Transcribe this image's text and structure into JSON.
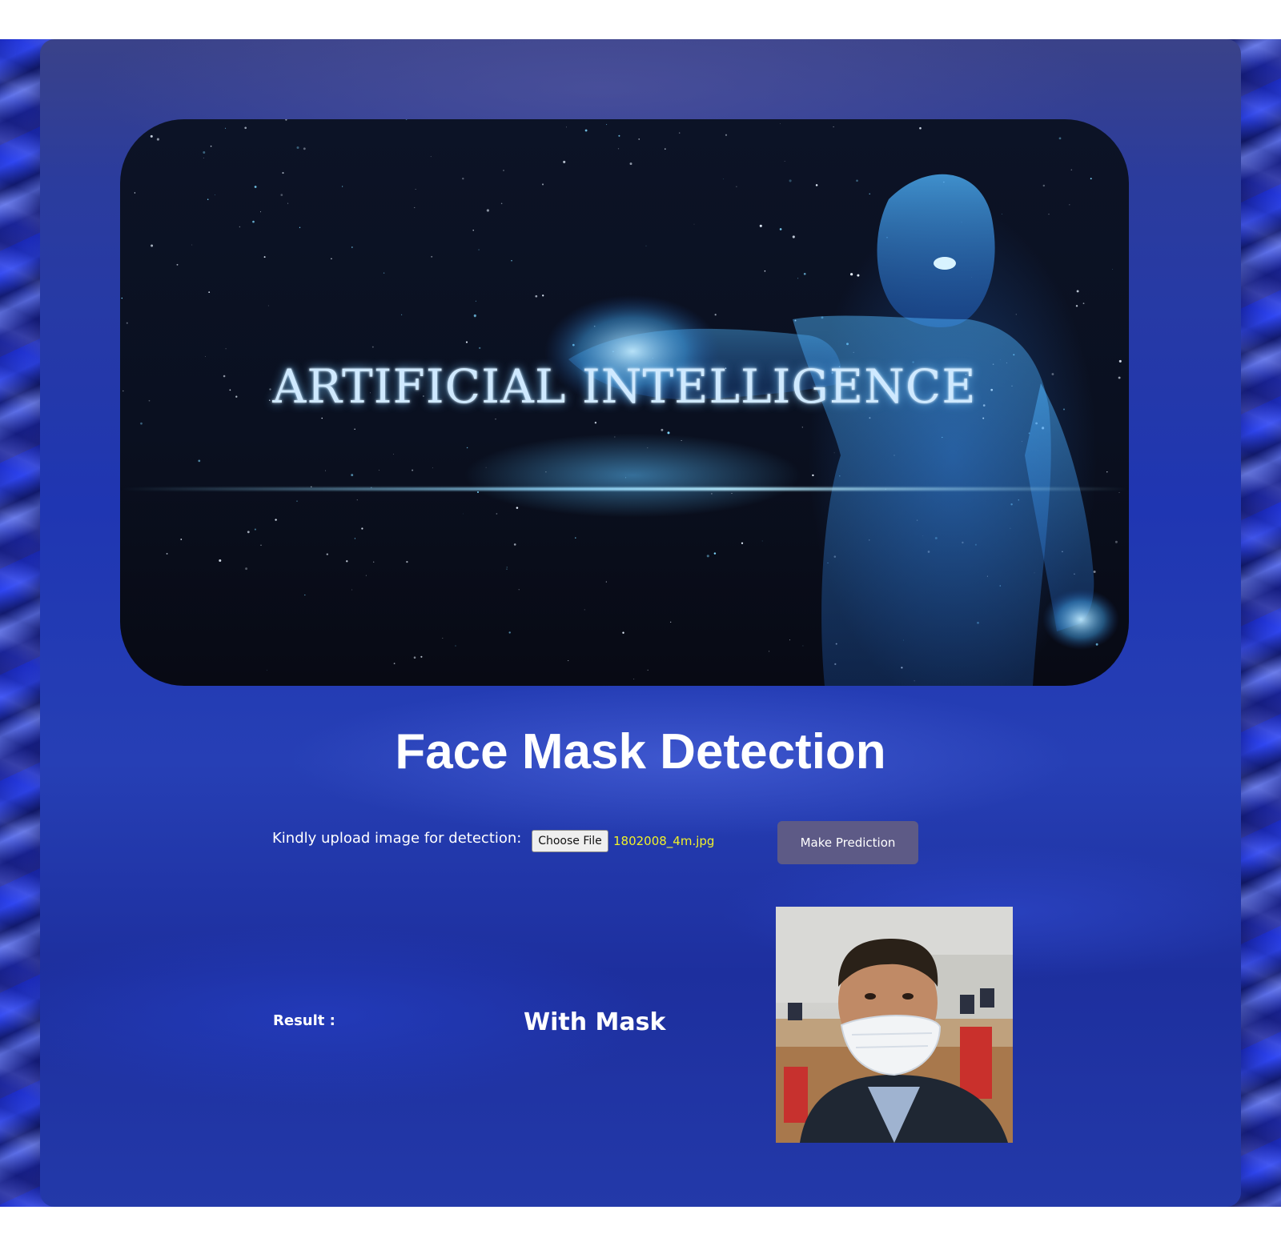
{
  "hero": {
    "text": "ARTIFICIAL INTELLIGENCE",
    "icon": "ai-hologram-figure"
  },
  "title": "Face Mask Detection",
  "upload": {
    "label": "Kindly upload image for detection:",
    "choose_file_label": "Choose File",
    "file_name": "1802008_4m.jpg"
  },
  "predict_button": "Make Prediction",
  "result": {
    "label": "Result :",
    "value": "With Mask",
    "photo_icon": "person-with-face-mask-photo"
  },
  "colors": {
    "page_background": "#1c2aa6",
    "card_background": "#2339a9",
    "button_background": "#5d5a86",
    "file_name_color": "#f1f12a",
    "text_color": "#ffffff"
  }
}
